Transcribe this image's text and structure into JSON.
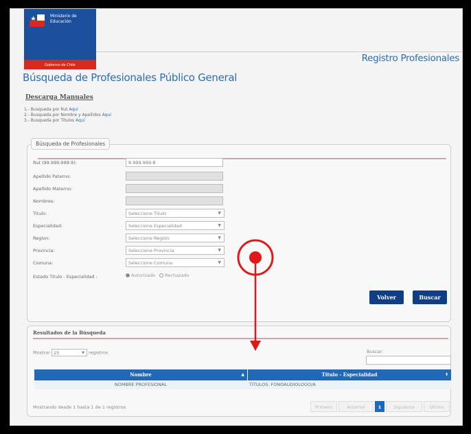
{
  "header": {
    "logo_line1": "Ministerio de",
    "logo_line2": "Educación",
    "logo_gob": "Gobierno de Chile",
    "app_title": "Registro Profesionales"
  },
  "page": {
    "title": "Búsqueda de Profesionales Público General"
  },
  "manuales": {
    "title": "Descarga Manuales",
    "items": [
      {
        "text": "1.- Busqueda por Rut ",
        "link": "Aquí"
      },
      {
        "text": "2.- Busqueda por Nombre y Apellidos ",
        "link": "Aquí"
      },
      {
        "text": "3.- Busqueda por Titulos ",
        "link": "Aquí"
      }
    ]
  },
  "form": {
    "legend": "Búsqueda de Profesionales",
    "rut_label": "Rut (99.999.999-9):",
    "rut_value": "8.999.999-8",
    "paterno_label": "Apellido Paterno:",
    "materno_label": "Apellido Materno:",
    "nombres_label": "Nombres:",
    "titulo_label": "Titulo:",
    "titulo_value": "Seleccione Titulo",
    "especialidad_label": "Especialidad:",
    "especialidad_value": "Seleccione Especialidad",
    "region_label": "Region:",
    "region_value": "Seleccione Región",
    "provincia_label": "Provincia:",
    "provincia_value": "Seleccione Provincia",
    "comuna_label": "Comuna:",
    "comuna_value": "Seleccione Comuna",
    "estado_label": "Estado Titulo - Especialidad :",
    "estado_opt1": "Autorizado",
    "estado_opt2": "Rechazado",
    "btn_volver": "Volver",
    "btn_buscar": "Buscar"
  },
  "results": {
    "title": "Resultados de la Búsqueda",
    "mostrar": "Mostrar",
    "page_size": "25",
    "registros": "registros",
    "buscar_label": "Buscar:",
    "col_nombre": "Nombre",
    "col_titulo": "Titulo - Especialidad",
    "rows": [
      {
        "nombre": "NOMBRE PROFESIONAL",
        "titulo": "TITULOS: FONOAUDIOLOGO/A"
      }
    ],
    "info": "Mostrando desde 1 hasta 1 de 1 registros",
    "pager": {
      "primero": "Primero",
      "anterior": "Anterior",
      "current": "1",
      "siguiente": "Siguiente",
      "ultimo": "Último"
    }
  },
  "colors": {
    "brand_blue": "#1c4f9c",
    "brand_red": "#d52b1e",
    "title_blue": "#2a6eb5",
    "button_blue": "#0f3d86",
    "annotation_red": "#e01818"
  },
  "annotation": {
    "icon": "click-target-circle-icon",
    "arrow": "arrow-down-icon"
  }
}
